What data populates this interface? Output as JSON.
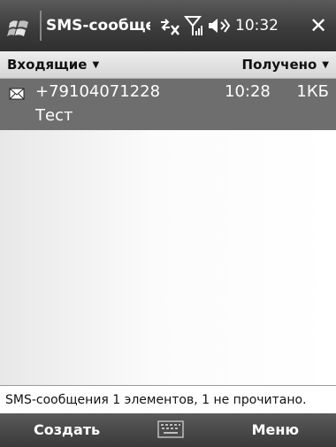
{
  "titlebar": {
    "title": "SMS-сообщени",
    "clock": "10:32",
    "close": "✕",
    "icons": [
      "windows-start-icon",
      "connectivity-icon",
      "signal-strength-icon",
      "volume-icon"
    ]
  },
  "sortbar": {
    "folder": "Входящие",
    "sort": "Получено"
  },
  "messages": [
    {
      "sender": "+79104071228",
      "time": "10:28",
      "size": "1КБ",
      "subject": "Тест",
      "icon": "envelope-icon"
    }
  ],
  "status": {
    "text": "SMS-сообщения  1 элементов, 1 не прочитано."
  },
  "softkeys": {
    "left": "Создать",
    "right": "Меню",
    "center_icon": "keyboard-icon"
  },
  "colors": {
    "titlebar": "#3c3c3c",
    "selected_row": "#6e6e6e",
    "softbar": "#444444"
  }
}
